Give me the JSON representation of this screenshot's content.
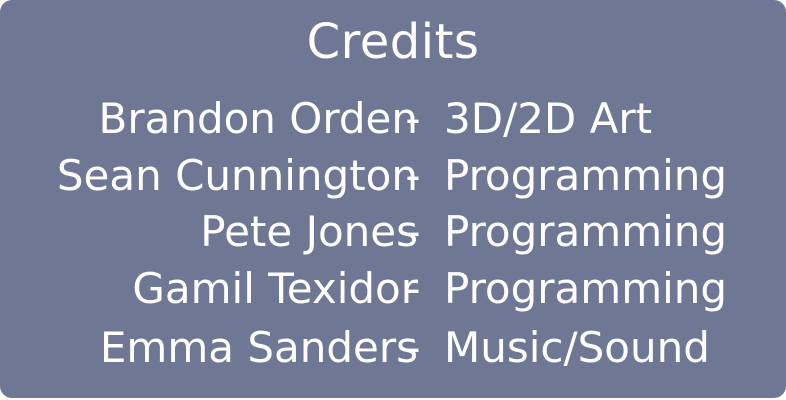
{
  "title": "Credits",
  "separator": "-",
  "credits": [
    {
      "name": "Brandon Orden",
      "role": "3D/2D Art"
    },
    {
      "name": "Sean Cunnington",
      "role": "Programming"
    },
    {
      "name": "Pete Jones",
      "role": "Programming"
    },
    {
      "name": "Gamil Texidor",
      "role": "Programming"
    },
    {
      "name": "Emma Sanders",
      "role": "Music/Sound"
    }
  ],
  "colors": {
    "panel_background": "#6e7894",
    "text": "#ffffff"
  }
}
